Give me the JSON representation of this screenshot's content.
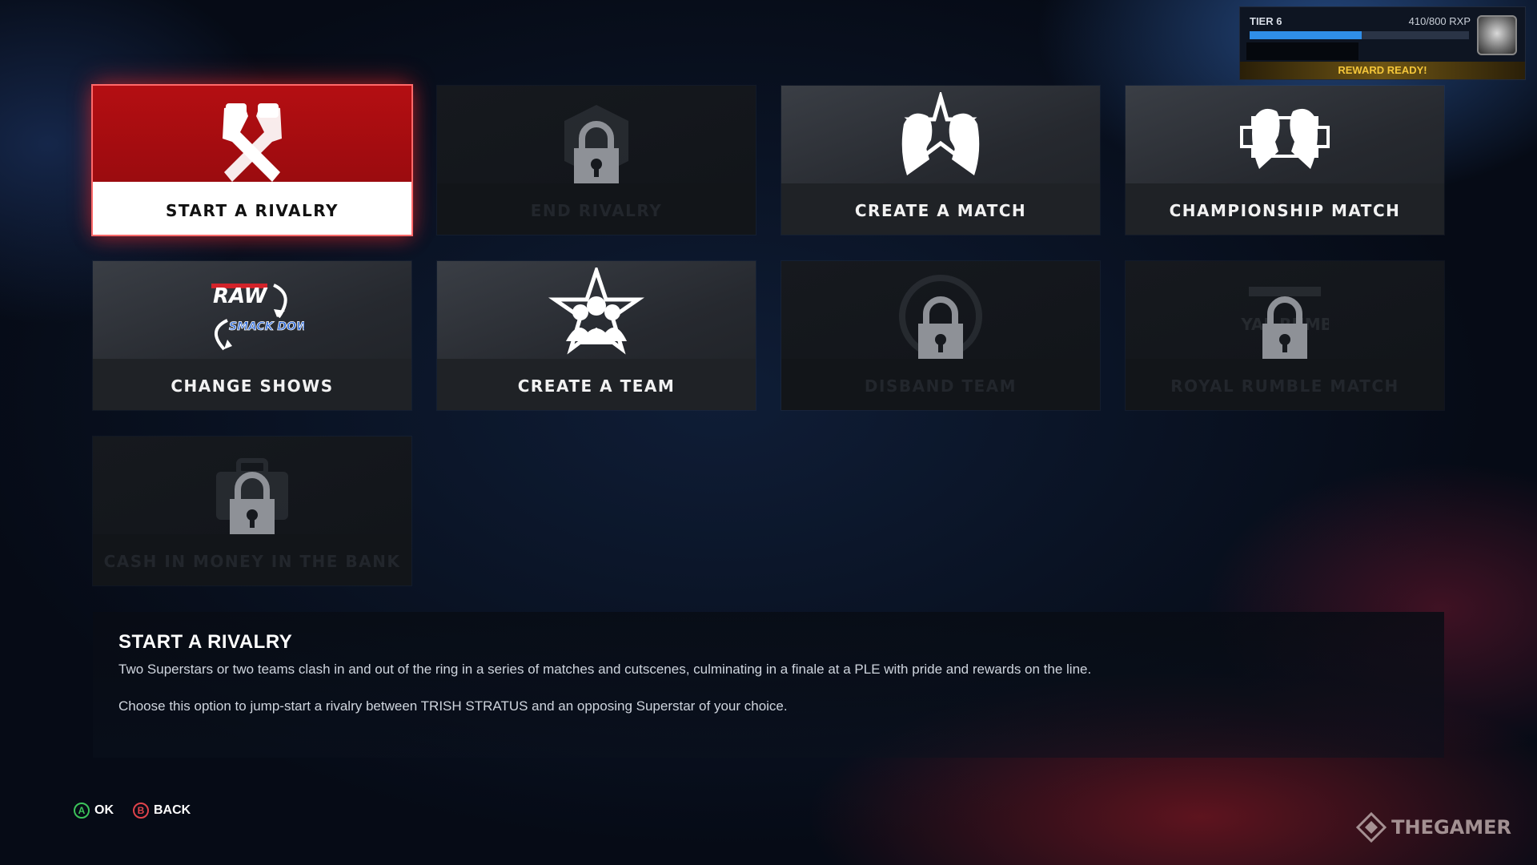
{
  "reward": {
    "tier": "TIER 6",
    "rxp": "410/800 RXP",
    "progress": 0.51,
    "status": "REWARD READY!"
  },
  "tiles": {
    "start_rivalry": {
      "label": "START A RIVALRY",
      "locked": false,
      "selected": true
    },
    "end_rivalry": {
      "label": "END RIVALRY",
      "locked": true
    },
    "create_match": {
      "label": "CREATE A MATCH",
      "locked": false
    },
    "championship_match": {
      "label": "CHAMPIONSHIP MATCH",
      "locked": false
    },
    "change_shows": {
      "label": "CHANGE SHOWS",
      "locked": false,
      "logo_top": "RAW",
      "logo_bottom": "SMACK DOWN"
    },
    "create_team": {
      "label": "CREATE A TEAM",
      "locked": false
    },
    "disband_team": {
      "label": "DISBAND TEAM",
      "locked": true
    },
    "royal_rumble": {
      "label": "ROYAL RUMBLE MATCH",
      "locked": true,
      "ghost_text": "ROYAL RUMBLE"
    },
    "cash_in": {
      "label": "CASH IN MONEY IN THE BANK",
      "locked": true
    }
  },
  "description": {
    "title": "START A RIVALRY",
    "line1": "Two Superstars or two teams clash in and out of the ring in a series of matches and cutscenes, culminating in a finale at a PLE with pride and rewards on the line.",
    "line2": "Choose this option to jump-start a rivalry between TRISH STRATUS and an opposing Superstar of your choice."
  },
  "controls": {
    "ok": {
      "button": "A",
      "label": "OK",
      "color": "#3cc35a"
    },
    "back": {
      "button": "B",
      "label": "BACK",
      "color": "#e0434b"
    }
  },
  "watermark": "THEGAMER"
}
